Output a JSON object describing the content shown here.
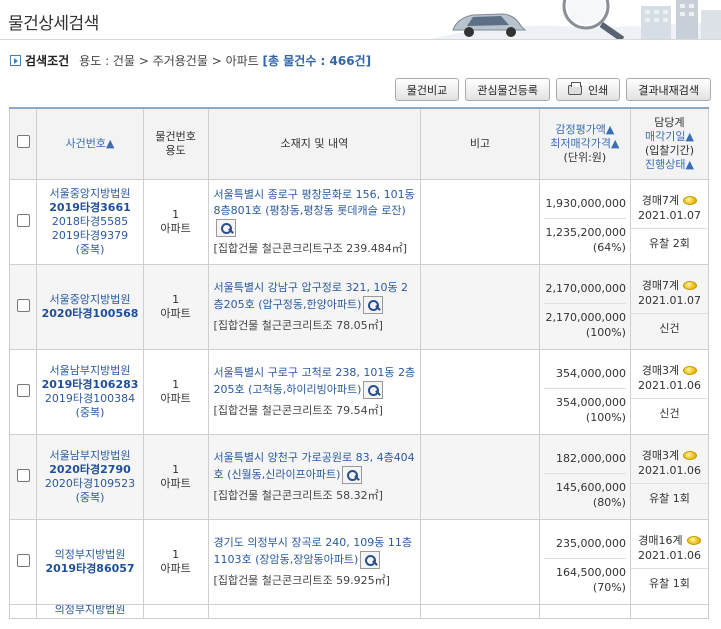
{
  "page": {
    "title": "물건상세검색"
  },
  "condition": {
    "label": "검색조건",
    "path": "용도 : 건물 > 주거용건물 > 아파트",
    "count_text": "[총 물건수 : 466건]"
  },
  "buttons": {
    "compare": "물건비교",
    "favorite": "관심물건등록",
    "print": "인쇄",
    "refine": "결과내재검색"
  },
  "columns": {
    "case_no": "사건번호▲",
    "item_no": "물건번호",
    "item_use": "용도",
    "location": "소재지 및 내역",
    "note": "비고",
    "appraisal": "감정평가액▲",
    "min_price": "최저매각가격▲",
    "unit": "(단위:원)",
    "officer": "담당계",
    "sale_date": "매각기일▲",
    "bid_period": "(입찰기간)",
    "status": "진행상태▲"
  },
  "rows": [
    {
      "court": "서울중앙지방법원",
      "case_no": "2019타경3661",
      "subs": [
        "2018타경5585",
        "2019타경9379",
        "(중복)"
      ],
      "item_no": "1",
      "use": "아파트",
      "address": "서울특별시 종로구 평창문화로 156, 101동 8층801호 (평창동,평창동 롯데캐슬 로잔)",
      "detail": "[집합건물 철근콘크리트구조 239.484㎡]",
      "appraisal": "1,930,000,000",
      "min_price": "1,235,200,000",
      "ratio": "(64%)",
      "dept": "경매7계",
      "date": "2021.01.07",
      "status": "유찰 2회"
    },
    {
      "court": "서울중앙지방법원",
      "case_no": "2020타경100568",
      "subs": [],
      "item_no": "1",
      "use": "아파트",
      "address": "서울특별시 강남구 압구정로 321, 10동 2층205호 (압구정동,한양아파트)",
      "detail": "[집합건물 철근콘크리트조 78.05㎡]",
      "appraisal": "2,170,000,000",
      "min_price": "2,170,000,000",
      "ratio": "(100%)",
      "dept": "경매7계",
      "date": "2021.01.07",
      "status": "신건"
    },
    {
      "court": "서울남부지방법원",
      "case_no": "2019타경106283",
      "subs": [
        "2019타경100384",
        "(중복)"
      ],
      "item_no": "1",
      "use": "아파트",
      "address": "서울특별시 구로구 고척로 238, 101동 2층205호 (고척동,하이리빙아파트)",
      "detail": "[집합건물 철근콘크리트조 79.54㎡]",
      "appraisal": "354,000,000",
      "min_price": "354,000,000",
      "ratio": "(100%)",
      "dept": "경매3계",
      "date": "2021.01.06",
      "status": "신건"
    },
    {
      "court": "서울남부지방법원",
      "case_no": "2020타경2790",
      "subs": [
        "2020타경109523",
        "(중복)"
      ],
      "item_no": "1",
      "use": "아파트",
      "address": "서울특별시 양천구 가로공원로 83, 4층404호 (신월동,신라이프아파트)",
      "detail": "[집합건물 철근콘크리트조 58.32㎡]",
      "appraisal": "182,000,000",
      "min_price": "145,600,000",
      "ratio": "(80%)",
      "dept": "경매3계",
      "date": "2021.01.06",
      "status": "유찰 1회"
    },
    {
      "court": "의정부지방법원",
      "case_no": "2019타경86057",
      "subs": [],
      "item_no": "1",
      "use": "아파트",
      "address": "경기도 의정부시 장곡로 240, 109동 11층1103호 (장암동,장암동아파트)",
      "detail": "[집합건물 철근콘크리트조 59.925㎡]",
      "appraisal": "235,000,000",
      "min_price": "164,500,000",
      "ratio": "(70%)",
      "dept": "경매16계",
      "date": "2021.01.06",
      "status": "유찰 1회"
    }
  ],
  "partial_row": {
    "court": "의정부지방법원"
  }
}
